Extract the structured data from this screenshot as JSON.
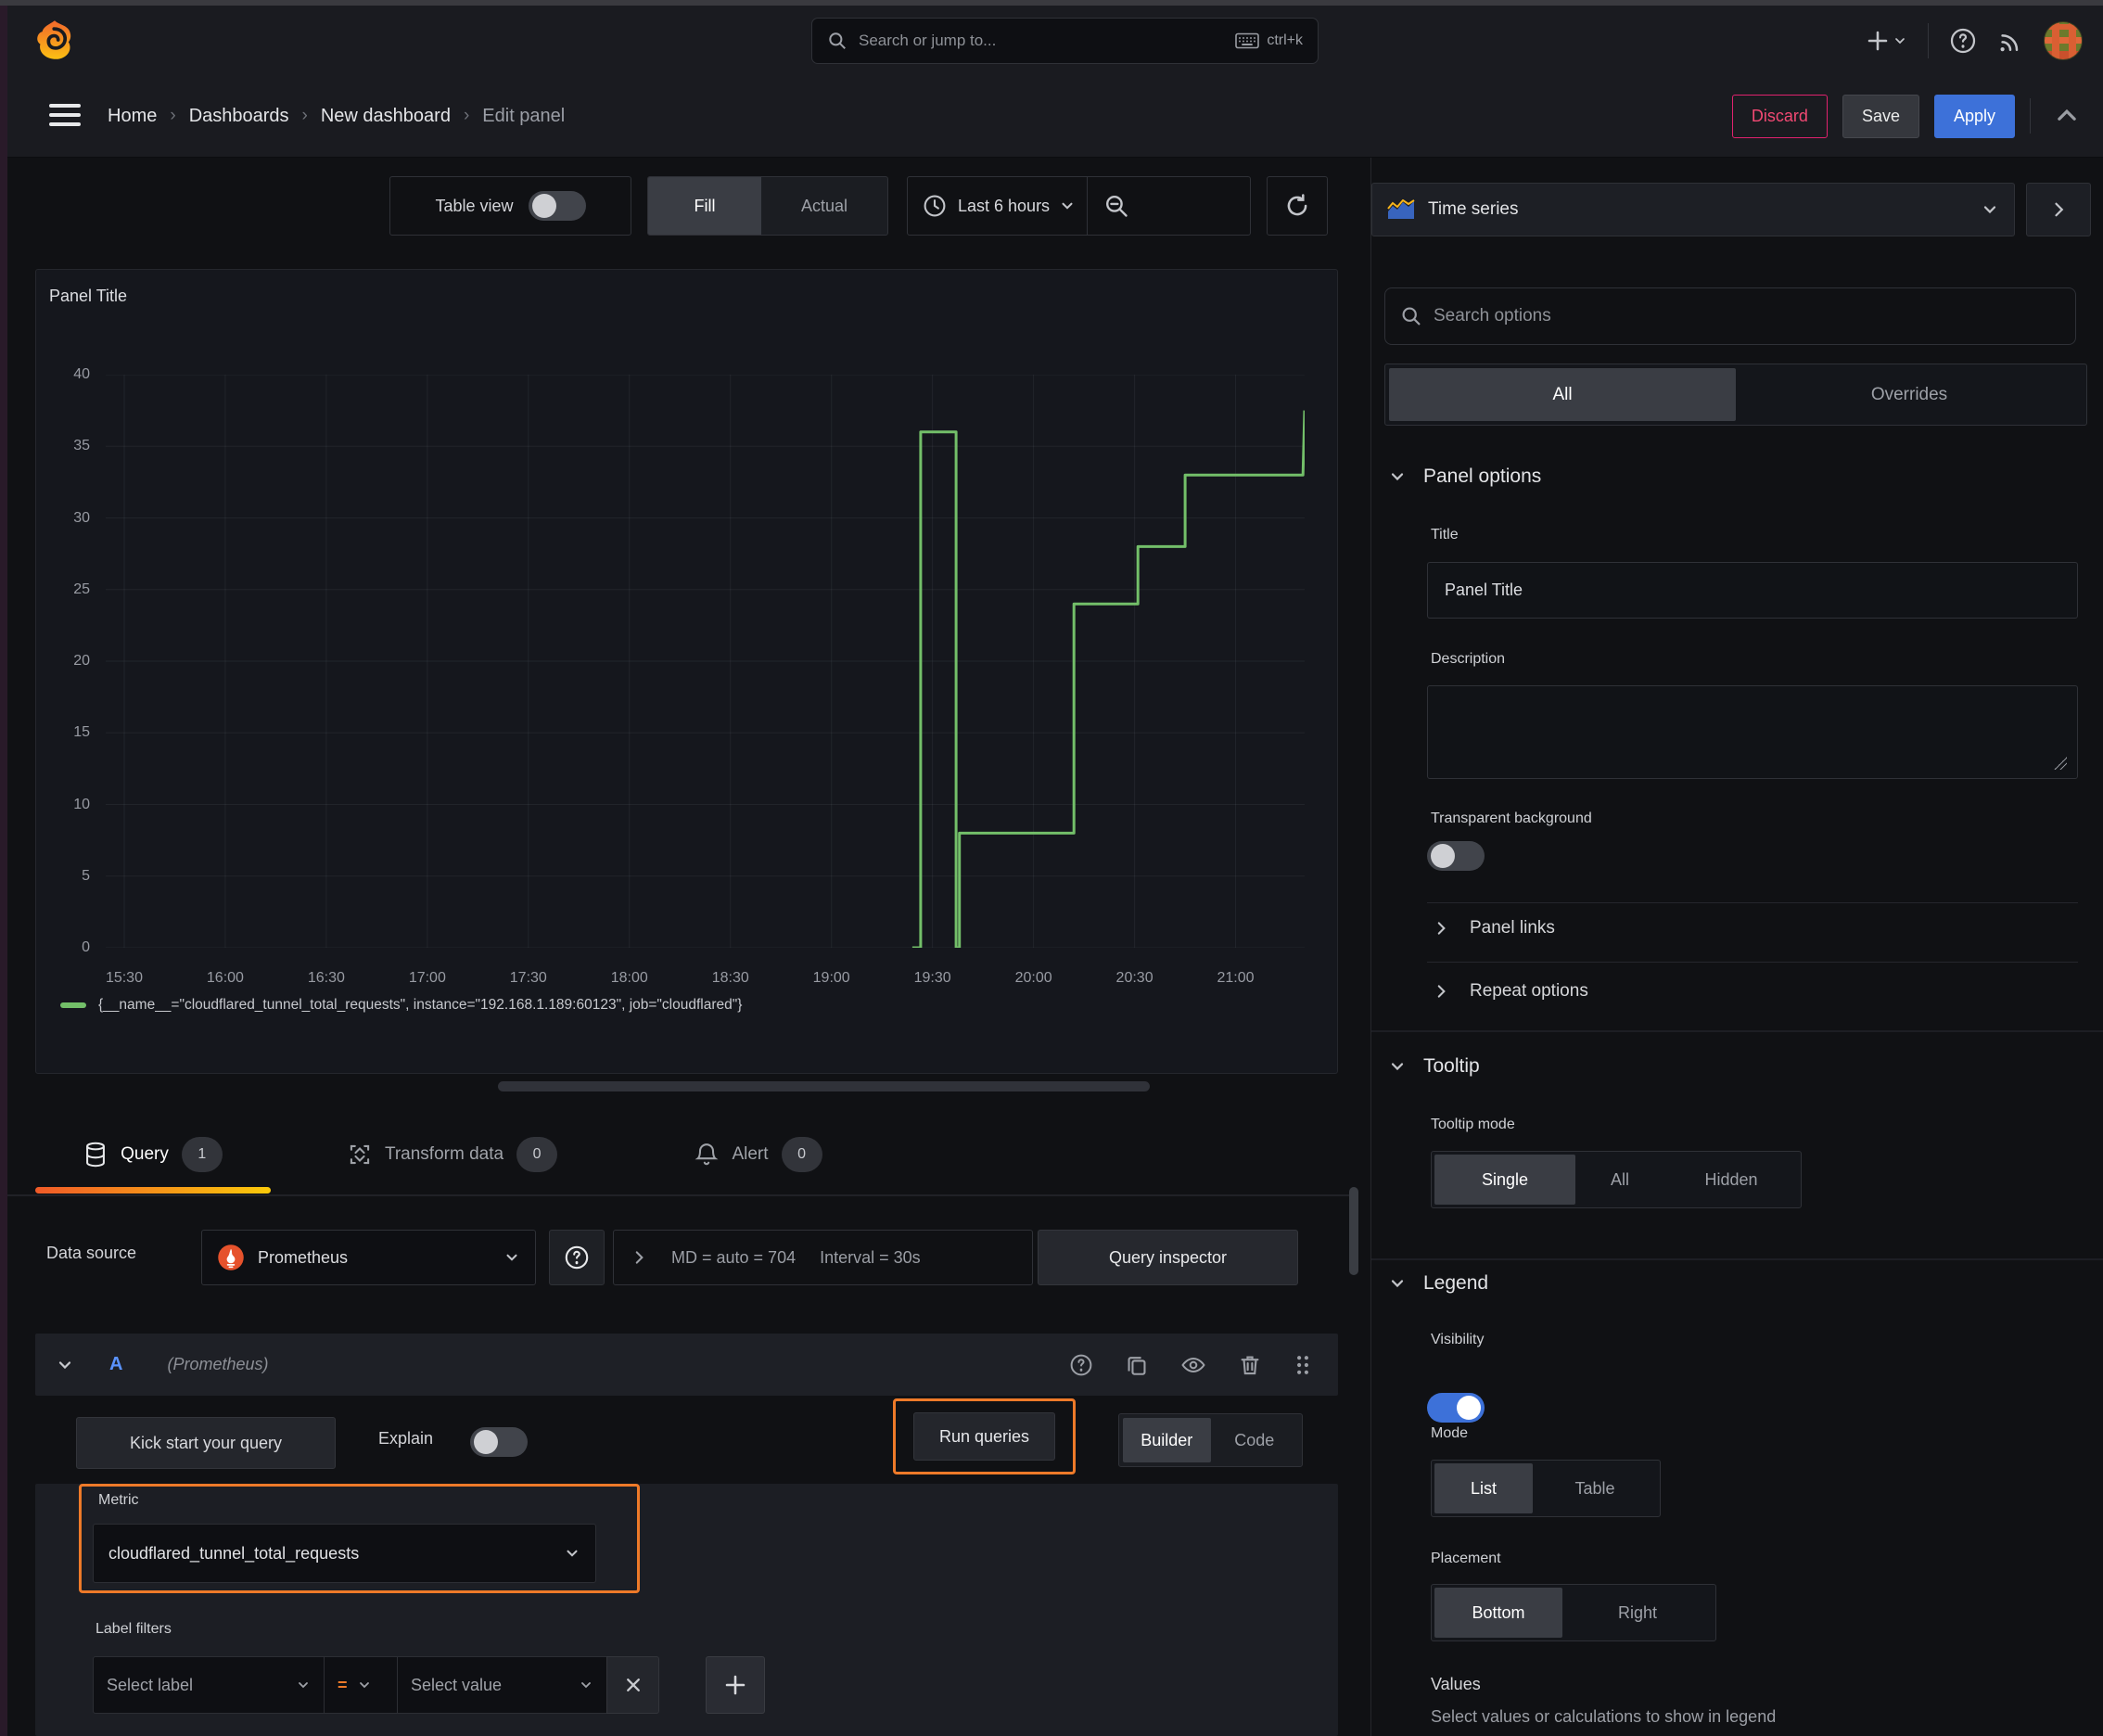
{
  "topnav": {
    "search_placeholder": "Search or jump to...",
    "shortcut": "ctrl+k"
  },
  "breadcrumb": {
    "items": [
      "Home",
      "Dashboards",
      "New dashboard",
      "Edit panel"
    ]
  },
  "actions": {
    "discard": "Discard",
    "save": "Save",
    "apply": "Apply"
  },
  "toolbar": {
    "table_view": "Table view",
    "fill": "Fill",
    "actual": "Actual",
    "time_range": "Last 6 hours"
  },
  "panel": {
    "title": "Panel Title"
  },
  "chart_data": {
    "type": "line",
    "title": "Panel Title",
    "xlabel": "",
    "ylabel": "",
    "ylim": [
      0,
      40
    ],
    "y_ticks": [
      0,
      5,
      10,
      15,
      20,
      25,
      30,
      35,
      40
    ],
    "x_ticks": [
      "15:30",
      "16:00",
      "16:30",
      "17:00",
      "17:30",
      "18:00",
      "18:30",
      "19:00",
      "19:30",
      "20:00",
      "20:30",
      "21:00"
    ],
    "x_tick_minutes": [
      0,
      30,
      60,
      90,
      120,
      150,
      180,
      210,
      240,
      270,
      300,
      330
    ],
    "x_domain_minutes": [
      -5.5,
      350.5
    ],
    "grid": true,
    "legend_position": "bottom",
    "series": [
      {
        "name": "{__name__=\"cloudflared_tunnel_total_requests\", instance=\"192.168.1.189:60123\", job=\"cloudflared\"}",
        "color": "#73BF69",
        "points_minutes_value": [
          [
            234,
            0
          ],
          [
            236.5,
            0
          ],
          [
            236.5,
            36
          ],
          [
            247,
            36
          ],
          [
            247,
            0
          ],
          [
            248,
            0
          ],
          [
            248,
            8
          ],
          [
            282,
            8
          ],
          [
            282,
            24
          ],
          [
            301,
            24
          ],
          [
            301,
            28
          ],
          [
            315,
            28
          ],
          [
            315,
            33
          ],
          [
            350,
            33
          ],
          [
            350.5,
            37.5
          ]
        ]
      }
    ]
  },
  "query_tabs": {
    "query": "Query",
    "query_count": "1",
    "transform": "Transform data",
    "transform_count": "0",
    "alert": "Alert",
    "alert_count": "0"
  },
  "datasource": {
    "label": "Data source",
    "name": "Prometheus",
    "stats": "MD = auto = 704",
    "interval": "Interval = 30s",
    "inspector": "Query inspector"
  },
  "query_row": {
    "ref_id": "A",
    "ds_hint": "(Prometheus)"
  },
  "query_toolbar": {
    "kickstart": "Kick start your query",
    "explain": "Explain",
    "run": "Run queries",
    "builder": "Builder",
    "code": "Code"
  },
  "metric": {
    "label": "Metric",
    "value": "cloudflared_tunnel_total_requests"
  },
  "label_filters": {
    "label": "Label filters",
    "select_label": "Select label",
    "operator": "=",
    "select_value": "Select value"
  },
  "sidebar": {
    "viz_name": "Time series",
    "search_placeholder": "Search options",
    "tabs": {
      "all": "All",
      "overrides": "Overrides"
    },
    "panel_options": {
      "title": "Panel options",
      "title_label": "Title",
      "title_value": "Panel Title",
      "description_label": "Description",
      "transparent_label": "Transparent background",
      "links": "Panel links",
      "repeat": "Repeat options"
    },
    "tooltip": {
      "title": "Tooltip",
      "mode_label": "Tooltip mode",
      "modes": [
        "Single",
        "All",
        "Hidden"
      ],
      "selected": "Single"
    },
    "legend": {
      "title": "Legend",
      "visibility_label": "Visibility",
      "mode_label": "Mode",
      "modes": [
        "List",
        "Table"
      ],
      "mode_selected": "List",
      "placement_label": "Placement",
      "placements": [
        "Bottom",
        "Right"
      ],
      "placement_selected": "Bottom",
      "values_label": "Values",
      "values_help": "Select values or calculations to show in legend"
    }
  },
  "colors": {
    "accent_highlight": "#EE7A29",
    "series_green": "#73BF69",
    "primary_blue": "#3D71D9",
    "danger_pink": "#E0226E"
  }
}
